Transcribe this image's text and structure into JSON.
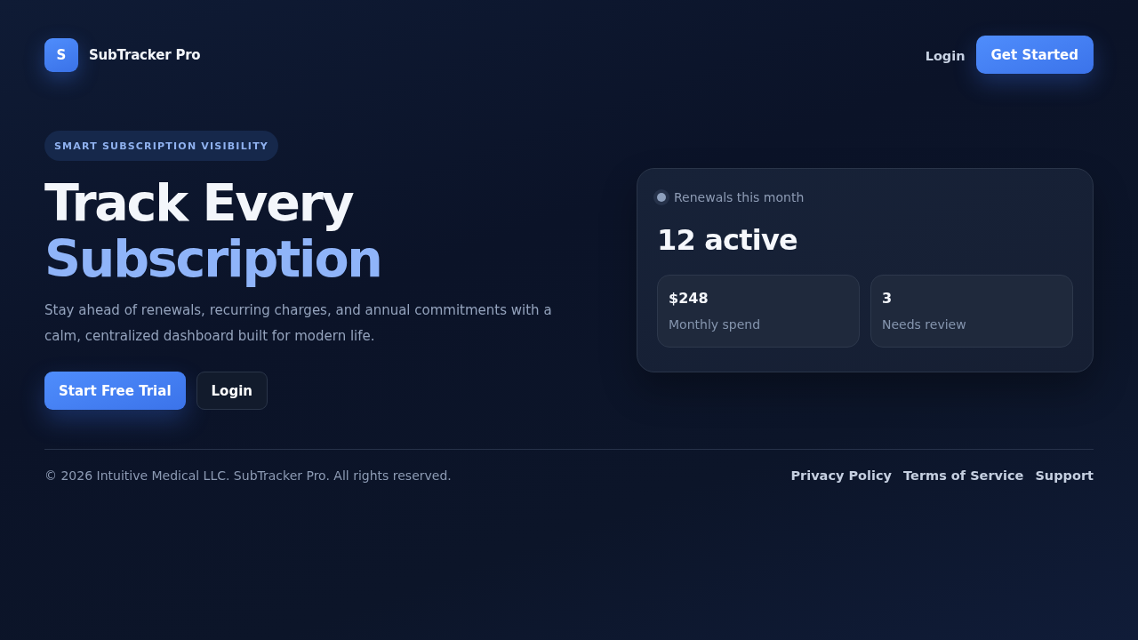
{
  "brand": {
    "logo_letter": "S",
    "name": "SubTracker Pro"
  },
  "nav": {
    "login": "Login",
    "cta": "Get Started"
  },
  "hero": {
    "badge": "SMART SUBSCRIPTION VISIBILITY",
    "title_lines": [
      {
        "text": "Track Every",
        "accent": false
      },
      {
        "text": "Subscription",
        "accent": true
      }
    ],
    "description": "Stay ahead of renewals, recurring charges, and annual commitments with a calm, centralized dashboard built for modern life.",
    "buttons": [
      {
        "label": "Start Free Trial",
        "kind": "primary"
      },
      {
        "label": "Login",
        "kind": "secondary"
      }
    ]
  },
  "summary_card": {
    "status_label": "Renewals this month",
    "headline": "12 active",
    "stats": [
      {
        "value": "$248",
        "label": "Monthly spend"
      },
      {
        "value": "3",
        "label": "Needs review"
      }
    ]
  },
  "footer": {
    "copyright": "© 2026 Intuitive Medical LLC. SubTracker Pro. All rights reserved.",
    "links": [
      "Privacy Policy",
      "Terms of Service",
      "Support"
    ]
  }
}
